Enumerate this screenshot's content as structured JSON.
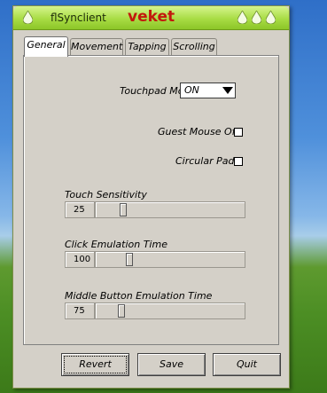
{
  "app": {
    "name": "flSynclient",
    "title": "veket"
  },
  "tabs": [
    {
      "label": "General",
      "active": true
    },
    {
      "label": "Movement",
      "active": false
    },
    {
      "label": "Tapping",
      "active": false
    },
    {
      "label": "Scrolling",
      "active": false
    }
  ],
  "general": {
    "touchpad_mode_label": "Touchpad Mode",
    "touchpad_mode_value": "ON",
    "guest_mouse_label": "Guest Mouse Off",
    "guest_mouse_checked": false,
    "circular_pad_label": "Circular Pad",
    "circular_pad_checked": false,
    "touch_sensitivity_label": "Touch Sensitivity",
    "touch_sensitivity_value": "25",
    "click_emulation_label": "Click Emulation Time",
    "click_emulation_value": "100",
    "middle_button_label": "Middle Button Emulation Time",
    "middle_button_value": "75"
  },
  "buttons": {
    "revert": "Revert",
    "save": "Save",
    "quit": "Quit"
  },
  "colors": {
    "titlebar": "#a8dc44",
    "title_accent": "#c2190d",
    "panel": "#d4d0c8"
  }
}
